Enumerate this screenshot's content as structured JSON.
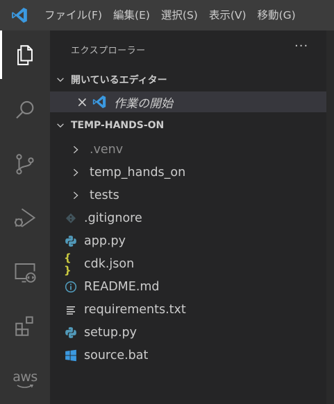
{
  "menu": [
    "ファイル(F)",
    "編集(E)",
    "選択(S)",
    "表示(V)",
    "移動(G)"
  ],
  "activity_bar": [
    "explorer",
    "search",
    "source-control",
    "run-and-debug",
    "remote-explorer",
    "extensions",
    "aws"
  ],
  "aws_label": "aws",
  "sidebar": {
    "title": "エクスプローラー",
    "more_label": "···",
    "open_editors": {
      "header": "開いているエディター",
      "items": [
        {
          "name": "作業の開始",
          "close_label": "×"
        }
      ]
    },
    "project": {
      "header": "TEMP-HANDS-ON",
      "items": [
        {
          "name": ".venv",
          "kind": "folder",
          "dim": true
        },
        {
          "name": "temp_hands_on",
          "kind": "folder"
        },
        {
          "name": "tests",
          "kind": "folder"
        },
        {
          "name": ".gitignore",
          "kind": "git"
        },
        {
          "name": "app.py",
          "kind": "python"
        },
        {
          "name": "cdk.json",
          "kind": "json",
          "icon_label": "{ }"
        },
        {
          "name": "README.md",
          "kind": "info"
        },
        {
          "name": "requirements.txt",
          "kind": "text"
        },
        {
          "name": "setup.py",
          "kind": "python"
        },
        {
          "name": "source.bat",
          "kind": "windows"
        }
      ]
    }
  },
  "colors": {
    "titlebar": "#3c3c3c",
    "activitybar": "#333333",
    "sidebar": "#252526",
    "selected_row": "#37373d",
    "vscode_blue": "#3b99e0",
    "python_blue": "#519aba",
    "json_yellow": "#cbcb41"
  }
}
